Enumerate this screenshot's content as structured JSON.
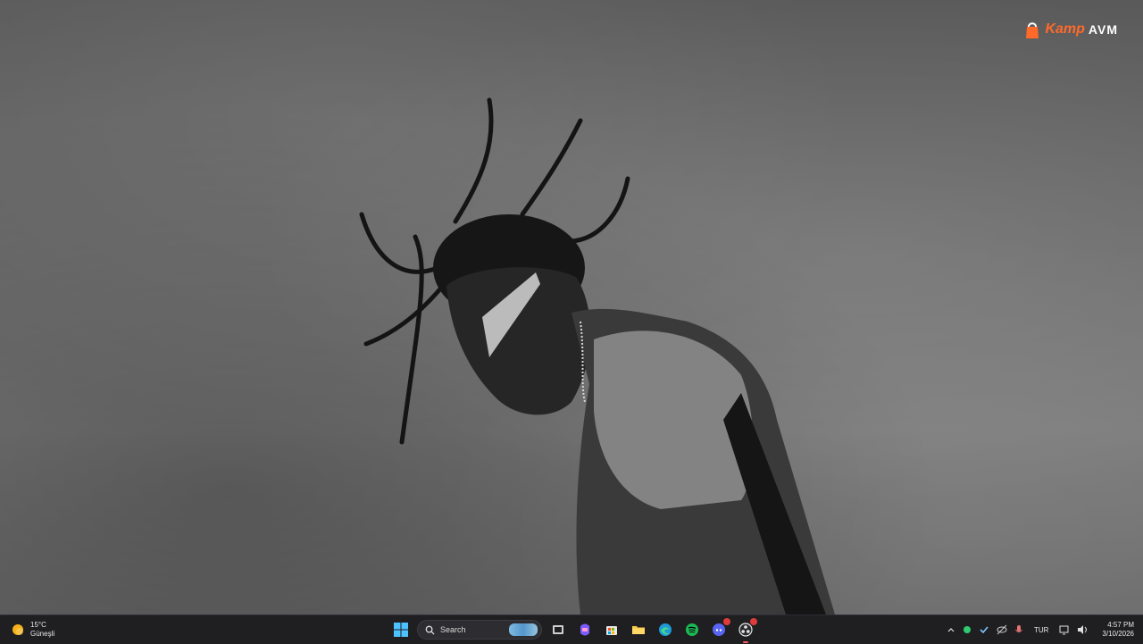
{
  "wallpaper": {
    "watermark_brand_a": "Kamp",
    "watermark_brand_b": "AVM"
  },
  "taskbar": {
    "weather": {
      "temperature": "15°C",
      "condition": "Güneşli",
      "icon": "sun-icon"
    },
    "start_icon": "windows-start-icon",
    "search": {
      "placeholder": "Search",
      "icon": "search-icon"
    },
    "pinned_apps": [
      {
        "name": "task-view",
        "icon": "task-view-icon"
      },
      {
        "name": "copilot",
        "icon": "copilot-icon"
      },
      {
        "name": "microsoft-store",
        "icon": "store-icon"
      },
      {
        "name": "file-explorer",
        "icon": "folder-icon"
      },
      {
        "name": "edge",
        "icon": "edge-icon"
      },
      {
        "name": "spotify",
        "icon": "spotify-icon"
      },
      {
        "name": "discord",
        "icon": "discord-icon",
        "badge": ""
      },
      {
        "name": "obs",
        "icon": "obs-icon",
        "active": true
      }
    ],
    "tray": {
      "language": "TUR",
      "icons": [
        "chevron-up-icon",
        "status-green-dot-icon",
        "check-app-icon",
        "eye-off-icon",
        "microphone-icon",
        "network-icon",
        "volume-icon"
      ]
    },
    "clock": {
      "time": "4:57 PM",
      "date": "3/10/2026"
    }
  },
  "colors": {
    "taskbar_bg": "#1f1f22",
    "accent_orange": "#ff6a2a",
    "spotify_green": "#1db954",
    "discord_blue": "#5865f2"
  }
}
